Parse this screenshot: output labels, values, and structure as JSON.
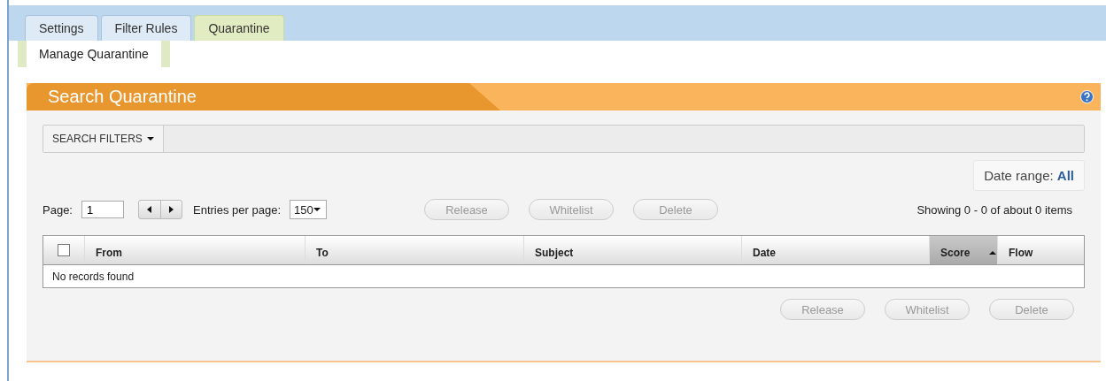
{
  "tabs": [
    {
      "label": "Settings",
      "selected": false
    },
    {
      "label": "Filter Rules",
      "selected": false
    },
    {
      "label": "Quarantine",
      "selected": true
    }
  ],
  "subtabs": [
    {
      "label": "Manage Quarantine",
      "selected": true
    }
  ],
  "panel": {
    "title": "Search Quarantine",
    "search_filters": "SEARCH FILTERS",
    "date_range_label": "Date range:",
    "date_range_value": "All"
  },
  "pager": {
    "page_label": "Page:",
    "page": "1",
    "entries_label": "Entries per page:",
    "entries": "150"
  },
  "top_buttons": [
    {
      "label": "Release",
      "disabled": true
    },
    {
      "label": "Whitelist",
      "disabled": true
    },
    {
      "label": "Delete",
      "disabled": true
    }
  ],
  "showing": "Showing 0 - 0 of about 0 items",
  "table": {
    "select_all_checked": false,
    "columns": [
      {
        "label": "From",
        "sorted": false
      },
      {
        "label": "To",
        "sorted": false
      },
      {
        "label": "Subject",
        "sorted": false
      },
      {
        "label": "Date",
        "sorted": false
      },
      {
        "label": "Score",
        "sorted": true
      },
      {
        "label": "Flow",
        "sorted": false
      }
    ],
    "empty_text": "No records found"
  },
  "bottom_buttons": [
    {
      "label": "Release",
      "disabled": true
    },
    {
      "label": "Whitelist",
      "disabled": true
    },
    {
      "label": "Delete",
      "disabled": true
    }
  ]
}
